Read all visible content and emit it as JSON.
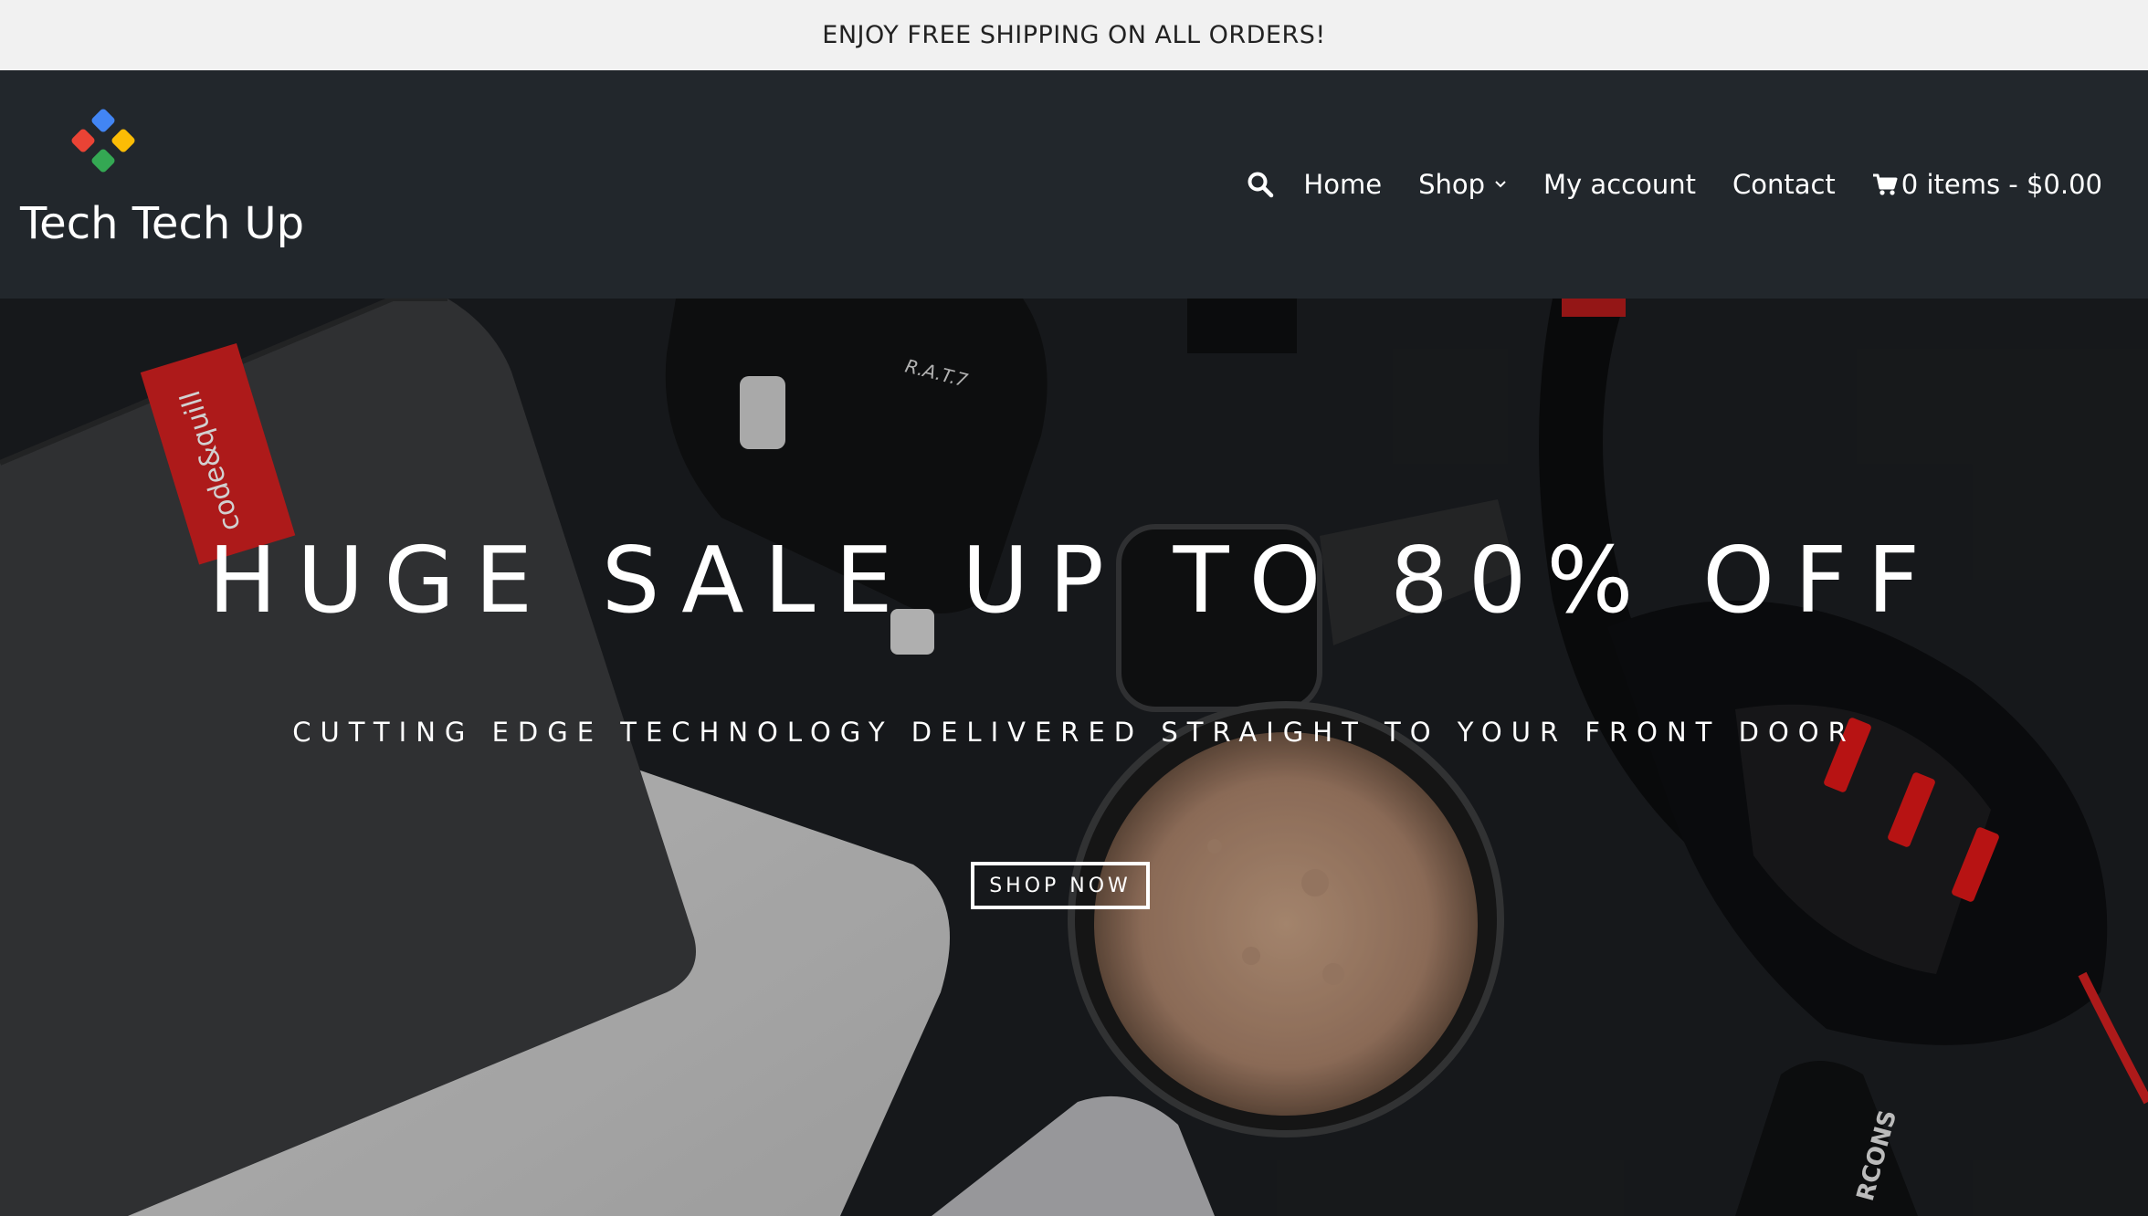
{
  "promo": {
    "text": "ENJOY FREE SHIPPING ON ALL ORDERS!"
  },
  "header": {
    "site_title": "Tech Tech Up",
    "logo_colors": [
      "#4285F4",
      "#EA4335",
      "#FBBC05",
      "#34A853"
    ],
    "nav": {
      "home": "Home",
      "shop": "Shop",
      "my_account": "My account",
      "contact": "Contact",
      "cart": "0 items - $0.00"
    },
    "icons": {
      "search": "search-icon",
      "shop_dropdown": "chevron-down-icon",
      "cart": "cart-icon"
    }
  },
  "hero": {
    "title": "HUGE SALE UP TO 80% OFF",
    "subtitle": "CUTTING EDGE TECHNOLOGY DELIVERED STRAIGHT TO YOUR FRONT DOOR",
    "cta": "SHOP NOW",
    "notebook_label": "code&quill",
    "mouse_label": "R.A.T.7",
    "device_label": "RCONS"
  },
  "colors": {
    "header_bg": "#22272c",
    "promo_bg": "#f1f1f1",
    "accent_red": "#d32020"
  }
}
